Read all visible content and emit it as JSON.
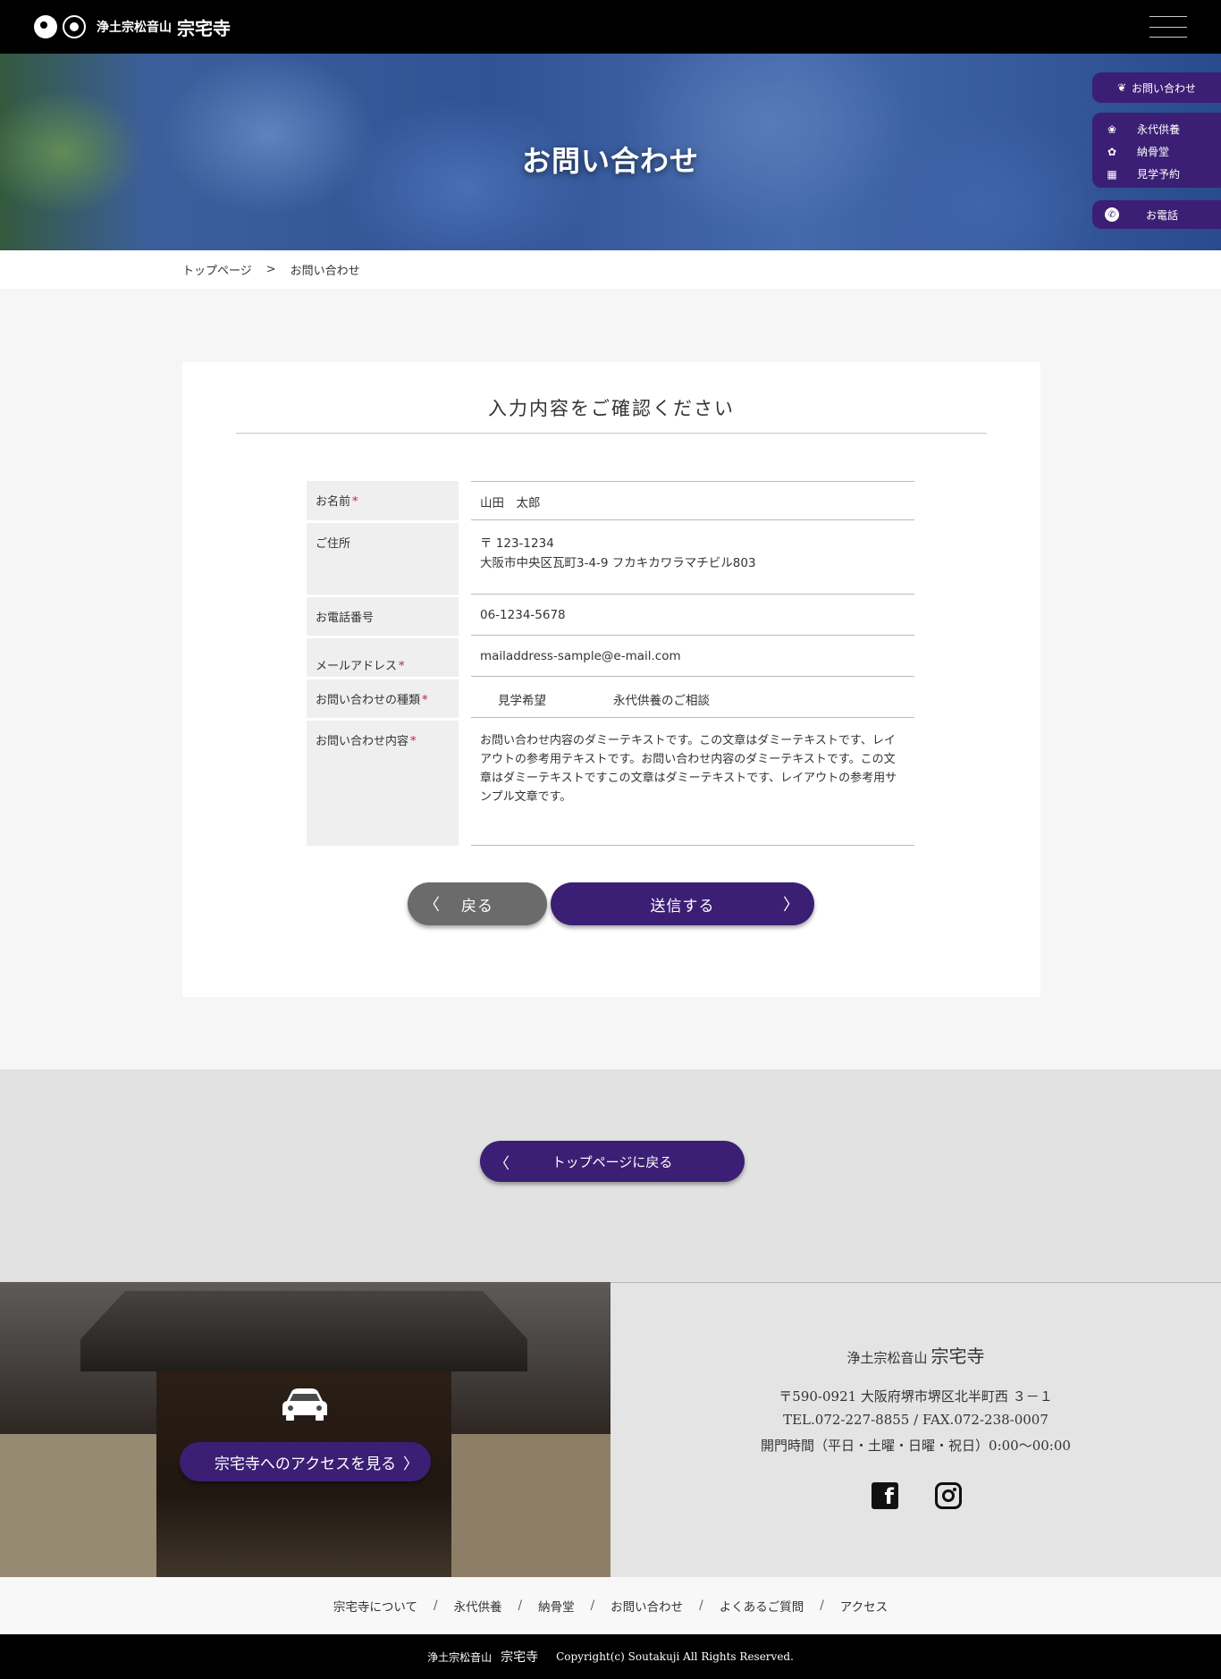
{
  "header": {
    "logo_sub": "浄土宗松音山",
    "logo_main": "宗宅寺"
  },
  "hero": {
    "title": "お問い合わせ"
  },
  "side_menu": {
    "contact": "お問い合わせ",
    "items": [
      "永代供養",
      "納骨堂",
      "見学予約"
    ],
    "phone": "お電話"
  },
  "breadcrumb": {
    "home": "トップページ",
    "separator": ">",
    "current": "お問い合わせ"
  },
  "confirm": {
    "title": "入力内容をご確認ください",
    "required_mark": "*",
    "fields": {
      "name": {
        "label": "お名前",
        "value": "山田　太郎"
      },
      "address": {
        "label": "ご住所",
        "postal": "〒 123-1234",
        "value": "大阪市中央区瓦町3-4-9 フカキカワラマチビル803"
      },
      "phone": {
        "label": "お電話番号",
        "value": "06-1234-5678"
      },
      "email": {
        "label": "メールアドレス",
        "value": "mailaddress-sample@e-mail.com"
      },
      "type": {
        "label": "お問い合わせの種類",
        "values": [
          "見学希望",
          "永代供養のご相談"
        ]
      },
      "content": {
        "label": "お問い合わせ内容",
        "value": "お問い合わせ内容のダミーテキストです。この文章はダミーテキストです、レイアウトの参考用テキストです。お問い合わせ内容のダミーテキストです。この文章はダミーテキストですこの文章はダミーテキストです、レイアウトの参考用サンプル文章です。"
      }
    },
    "back_button": "戻る",
    "send_button": "送信する"
  },
  "return_top": {
    "label": "トップページに戻る"
  },
  "access": {
    "button": "宗宅寺へのアクセスを見る"
  },
  "info": {
    "name_sub": "浄土宗松音山",
    "name_main": "宗宅寺",
    "address": "〒590-0921 大阪府堺市堺区北半町西 ３－１",
    "tel_fax": "TEL.072-227-8855 / FAX.072-238-0007",
    "hours": "開門時間（平日・土曜・日曜・祝日）0:00〜00:00"
  },
  "footer_nav": {
    "items": [
      "宗宅寺について",
      "永代供養",
      "納骨堂",
      "お問い合わせ",
      "よくあるご質問",
      "アクセス"
    ],
    "separator": "/"
  },
  "copyright": {
    "sub": "浄土宗松音山",
    "main": "宗宅寺",
    "text": "Copyright(c) Soutakuji All Rights Reserved."
  },
  "colors": {
    "brand_purple": "#3b1f74",
    "required_red": "#c2245a",
    "back_gray": "#6b6b6b"
  },
  "icons": {
    "side_contact": "flower-icon",
    "side_items": [
      "lotus-icon",
      "blossom-icon",
      "calendar-icon"
    ],
    "side_phone": "phone-icon",
    "access": "car-icon",
    "social": [
      "facebook-icon",
      "instagram-icon"
    ]
  }
}
